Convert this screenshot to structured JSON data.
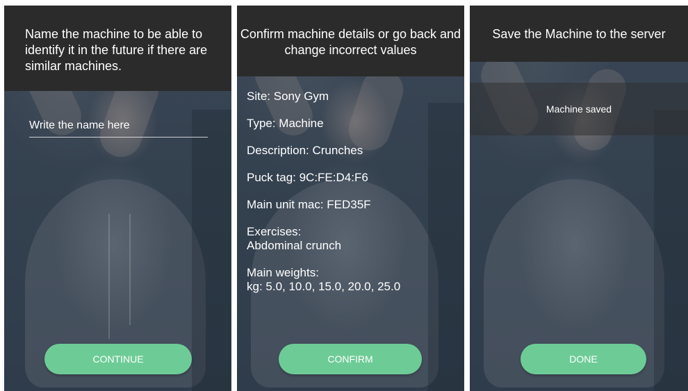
{
  "screen_name": {
    "header": "Name the machine to be able to identify it in the future if there are similar machines.",
    "input": {
      "value": "",
      "placeholder": "Write the name here"
    },
    "button_label": "CONTINUE"
  },
  "screen_confirm": {
    "header": "Confirm machine details or go back and change incorrect values",
    "details": [
      {
        "label": "Site: Sony Gym",
        "value": ""
      },
      {
        "label": "Type: Machine",
        "value": ""
      },
      {
        "label": "Description: Crunches",
        "value": ""
      },
      {
        "label": "Puck tag: 9C:FE:D4:F6",
        "value": ""
      },
      {
        "label": "Main unit mac: FED35F",
        "value": ""
      },
      {
        "label": "Exercises:",
        "value": "Abdominal crunch"
      },
      {
        "label": "Main weights:",
        "value": "kg: 5.0, 10.0, 15.0, 20.0, 25.0"
      }
    ],
    "button_label": "CONFIRM"
  },
  "screen_save": {
    "header": "Save the Machine to the server",
    "status": "Machine saved",
    "button_label": "DONE"
  },
  "colors": {
    "header_bg": "#2b2b2b",
    "button_bg": "#6dcc96",
    "overlay_bg": "#34414f"
  }
}
